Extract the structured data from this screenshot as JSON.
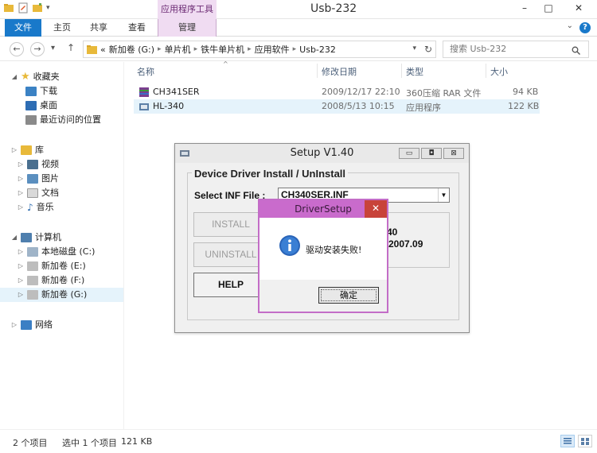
{
  "window": {
    "title": "Usb-232",
    "context_tab_group": "应用程序工具",
    "controls": {
      "minimize": "–",
      "maximize": "□",
      "close": "✕"
    }
  },
  "ribbon": {
    "tabs": [
      "文件",
      "主页",
      "共享",
      "查看",
      "管理"
    ],
    "help": "?"
  },
  "address": {
    "back": "←",
    "forward": "→",
    "up": "↑",
    "prefix": "«",
    "crumbs": [
      "新加卷 (G:)",
      "单片机",
      "铁牛单片机",
      "应用软件",
      "Usb-232"
    ],
    "search_placeholder": "搜索 Usb-232"
  },
  "nav": {
    "favorites": {
      "label": "收藏夹",
      "items": [
        "下载",
        "桌面",
        "最近访问的位置"
      ]
    },
    "library": {
      "label": "库",
      "items": [
        "视频",
        "图片",
        "文档",
        "音乐"
      ]
    },
    "computer": {
      "label": "计算机",
      "items": [
        "本地磁盘 (C:)",
        "新加卷 (E:)",
        "新加卷 (F:)",
        "新加卷 (G:)"
      ]
    },
    "network": {
      "label": "网络"
    }
  },
  "filelist": {
    "columns": {
      "name": "名称",
      "date": "修改日期",
      "type": "类型",
      "size": "大小"
    },
    "rows": [
      {
        "name": "CH341SER",
        "date": "2009/12/17 22:10",
        "type": "360压缩 RAR 文件",
        "size": "94 KB"
      },
      {
        "name": "HL-340",
        "date": "2008/5/13 10:15",
        "type": "应用程序",
        "size": "122 KB"
      }
    ]
  },
  "setup_dialog": {
    "title": "Setup V1.40",
    "group_label": "Device Driver Install / UnInstall",
    "inf_label": "Select INF File :",
    "inf_value": "CH340SER.INF",
    "install": "INSTALL",
    "uninstall": "UNINSTALL",
    "help": "HELP",
    "info_line1": "40",
    "info_line2": "1.2007.09"
  },
  "message_box": {
    "title": "DriverSetup",
    "close": "✕",
    "message": "驱动安装失败!",
    "ok": "确定"
  },
  "status": {
    "item_count": "2 个项目",
    "selection": "选中 1 个项目",
    "selection_size": "121 KB"
  }
}
